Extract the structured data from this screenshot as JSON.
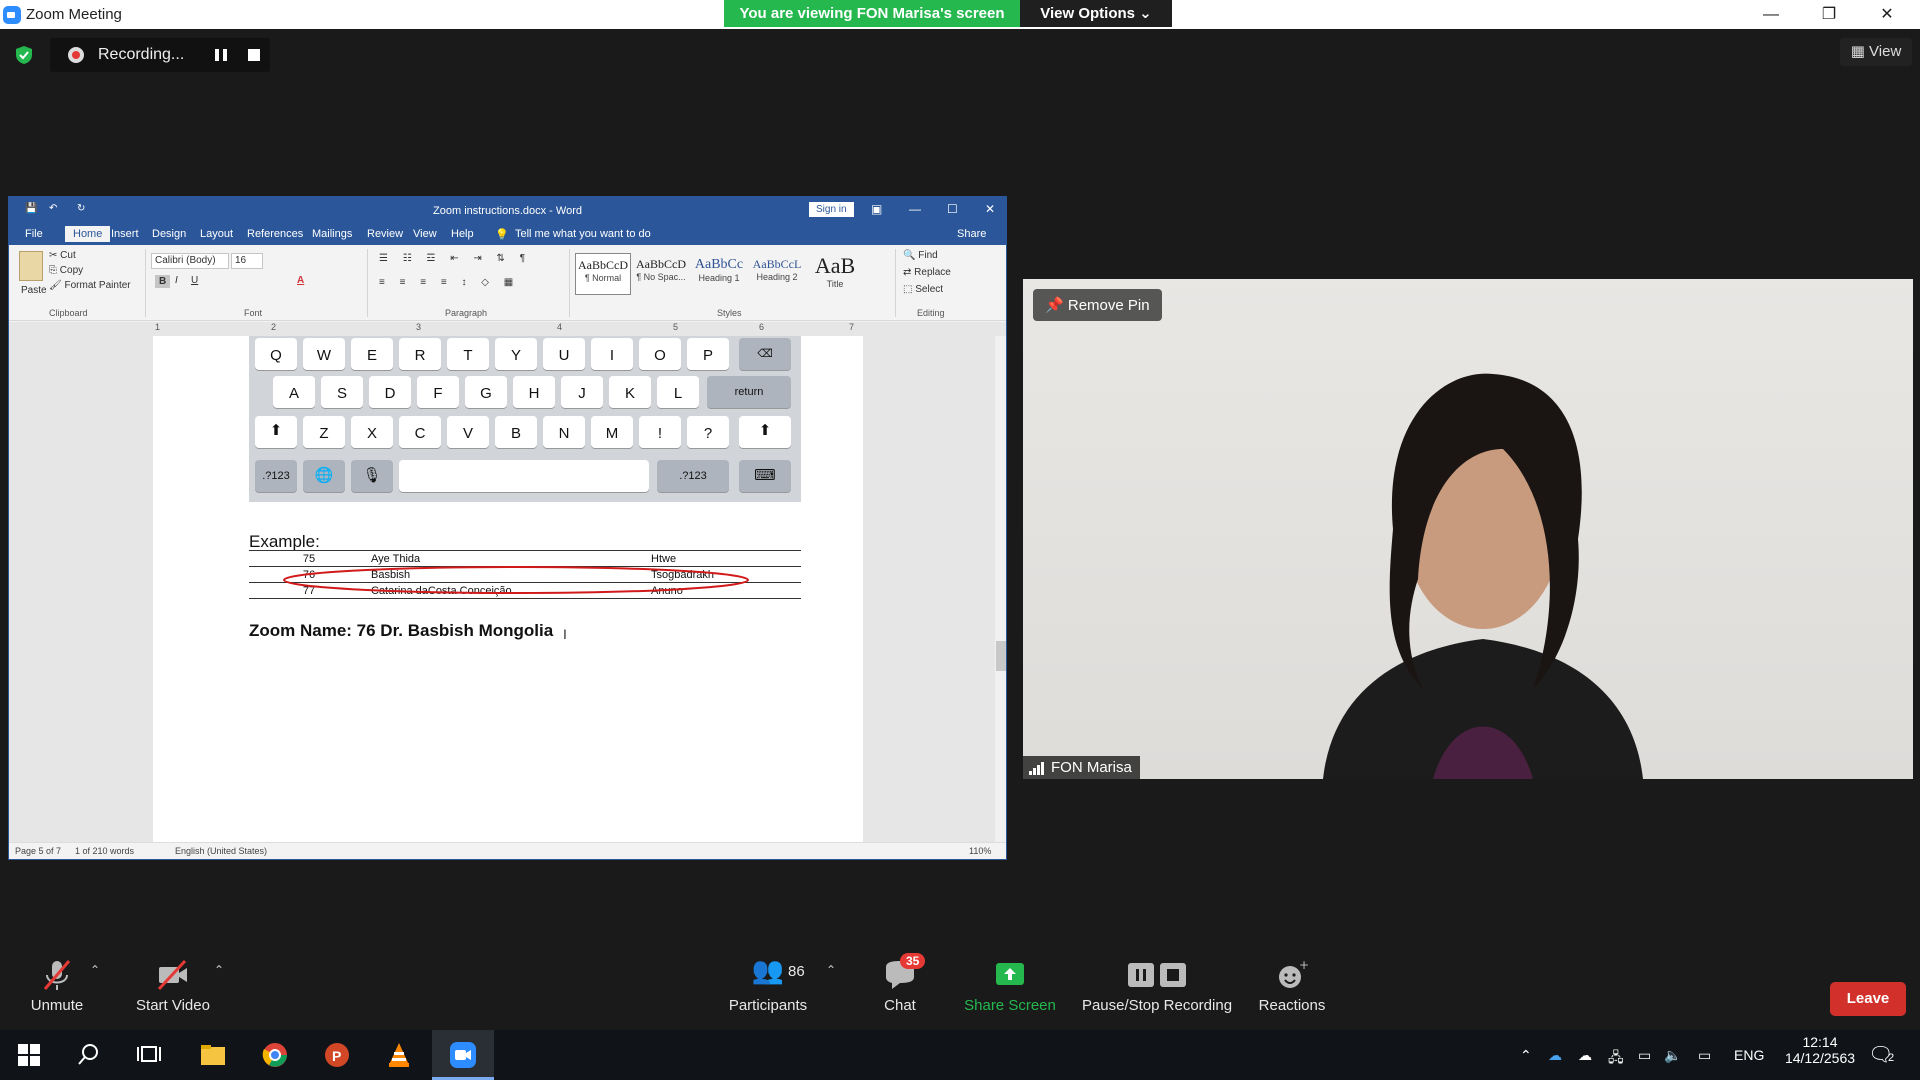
{
  "app": {
    "title": "Zoom Meeting",
    "viewing_banner": "You are viewing FON Marisa's screen",
    "view_options": "View Options",
    "recording_label": "Recording...",
    "view_button": "View"
  },
  "word": {
    "doc_title": "Zoom instructions.docx  -  Word",
    "sign_in": "Sign in",
    "tabs": [
      "File",
      "Home",
      "Insert",
      "Design",
      "Layout",
      "References",
      "Mailings",
      "Review",
      "View",
      "Help"
    ],
    "tell_me": "Tell me what you want to do",
    "share": "Share",
    "clipboard": {
      "paste": "Paste",
      "cut": "Cut",
      "copy": "Copy",
      "format_painter": "Format Painter",
      "label": "Clipboard"
    },
    "font": {
      "name": "Calibri (Body)",
      "size": "16",
      "label": "Font"
    },
    "paragraph_label": "Paragraph",
    "styles": [
      {
        "sample": "AaBbCcD",
        "name": "¶ Normal"
      },
      {
        "sample": "AaBbCcD",
        "name": "¶ No Spac..."
      },
      {
        "sample": "AaBbCc",
        "name": "Heading 1"
      },
      {
        "sample": "AaBbCcL",
        "name": "Heading 2"
      },
      {
        "sample": "AaB",
        "name": "Title"
      }
    ],
    "styles_label": "Styles",
    "editing": {
      "find": "Find",
      "replace": "Replace",
      "select": "Select",
      "label": "Editing"
    },
    "ruler_marks": [
      "1",
      "2",
      "3",
      "4",
      "5",
      "6",
      "7"
    ],
    "keyboard": {
      "row1": [
        "Q",
        "W",
        "E",
        "R",
        "T",
        "Y",
        "U",
        "I",
        "O",
        "P"
      ],
      "row2": [
        "A",
        "S",
        "D",
        "F",
        "G",
        "H",
        "J",
        "K",
        "L"
      ],
      "row3": [
        "Z",
        "X",
        "C",
        "V",
        "B",
        "N",
        "M",
        "!",
        "?"
      ],
      "return": "return",
      "num": ".?123"
    },
    "example_heading": "Example:",
    "example_rows": [
      [
        "75",
        "Aye Thida",
        "Htwe"
      ],
      [
        "76",
        "Basbish",
        "Tsogbadrakh"
      ],
      [
        "77",
        "Catarina daCosta Conceição",
        "Anuno"
      ]
    ],
    "zoom_name": "Zoom Name: 76 Dr. Basbish Mongolia",
    "status": {
      "page": "Page 5 of 7",
      "words": "1 of 210 words",
      "language": "English (United States)",
      "zoom": "110%"
    }
  },
  "video": {
    "remove_pin": "Remove Pin",
    "participant_name": "FON Marisa"
  },
  "toolbar": {
    "unmute": "Unmute",
    "start_video": "Start Video",
    "participants": "Participants",
    "participants_count": "86",
    "chat": "Chat",
    "chat_badge": "35",
    "share_screen": "Share Screen",
    "pause_stop": "Pause/Stop Recording",
    "reactions": "Reactions",
    "leave": "Leave"
  },
  "taskbar": {
    "language": "ENG",
    "time": "12:14",
    "date": "14/12/2563",
    "notification_count": "2"
  },
  "colors": {
    "zoom_green": "#24b84e",
    "word_blue": "#2b579a",
    "leave_red": "#d1302b",
    "share_green": "#24b84e"
  }
}
